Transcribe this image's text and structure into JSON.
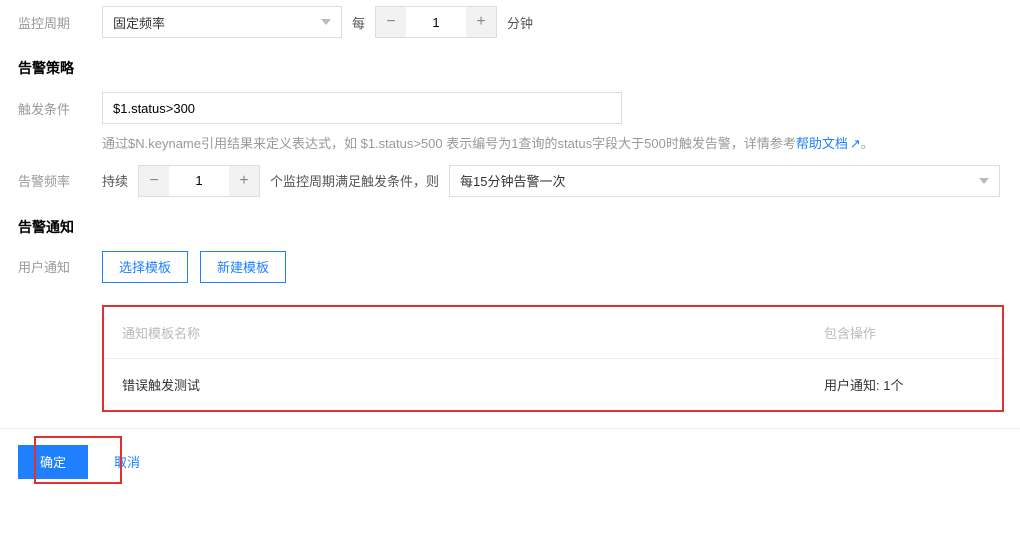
{
  "period": {
    "label": "监控周期",
    "mode": "固定频率",
    "every": "每",
    "value": "1",
    "unit": "分钟"
  },
  "strategy": {
    "title": "告警策略",
    "trigger_label": "触发条件",
    "trigger_value": "$1.status>300",
    "hint_prefix": "通过$N.keyname引用结果来定义表达式，如 $1.status>500 表示编号为1查询的status字段大于500时触发告警，详情参考",
    "help_link": "帮助文档",
    "hint_suffix": "。",
    "freq_label": "告警频率",
    "freq_prefix": "持续",
    "freq_value": "1",
    "freq_suffix": "个监控周期满足触发条件，则",
    "freq_option": "每15分钟告警一次"
  },
  "notify": {
    "title": "告警通知",
    "user_label": "用户通知",
    "select_tpl": "选择模板",
    "new_tpl": "新建模板",
    "th_name": "通知模板名称",
    "th_ops": "包含操作",
    "row_name": "错误触发测试",
    "row_ops": "用户通知: 1个"
  },
  "actions": {
    "ok": "确定",
    "cancel": "取消"
  }
}
